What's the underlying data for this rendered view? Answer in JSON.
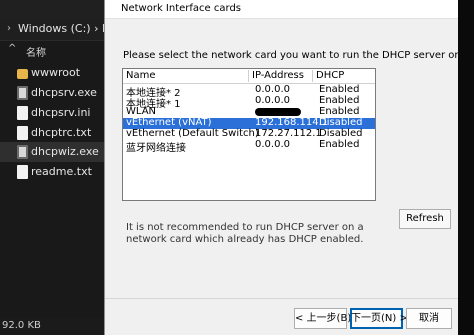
{
  "explorer": {
    "address_path": "Windows (C:) › Portab",
    "address_sep": "›",
    "column_header": "名称",
    "sort_indicator": "^",
    "files": [
      {
        "name": "wwwroot",
        "type": "folder"
      },
      {
        "name": "dhcpsrv.exe",
        "type": "exe"
      },
      {
        "name": "dhcpsrv.ini",
        "type": "doc"
      },
      {
        "name": "dhcptrc.txt",
        "type": "doc"
      },
      {
        "name": "dhcpwiz.exe",
        "type": "exe",
        "selected": true
      },
      {
        "name": "readme.txt",
        "type": "doc"
      }
    ],
    "status": "92.0 KB"
  },
  "dialog": {
    "title": "Network Interface cards",
    "prompt": "Please select the network card you want to run the DHCP server on:",
    "table": {
      "columns": [
        "Name",
        "IP-Address",
        "DHCP"
      ],
      "rows": [
        {
          "name": "本地连接* 2",
          "ip": "0.0.0.0",
          "dhcp": "Enabled"
        },
        {
          "name": "本地连接* 1",
          "ip": "0.0.0.0",
          "dhcp": "Enabled"
        },
        {
          "name": "WLAN",
          "ip": "",
          "dhcp": "Enabled"
        },
        {
          "name": "vEthernet (vNAT)",
          "ip": "192.168.114.1",
          "dhcp": "Disabled",
          "selected": true
        },
        {
          "name": "vEthernet (Default Switch)",
          "ip": "172.27.112.1",
          "dhcp": "Disabled"
        },
        {
          "name": "蓝牙网络连接",
          "ip": "0.0.0.0",
          "dhcp": "Enabled"
        }
      ]
    },
    "refresh_label": "Refresh",
    "warning": "It is not recommended to run DHCP server on a network card which already has DHCP enabled.",
    "buttons": {
      "back": "< 上一步(B)",
      "next": "下一页(N) >",
      "cancel": "取消"
    }
  }
}
